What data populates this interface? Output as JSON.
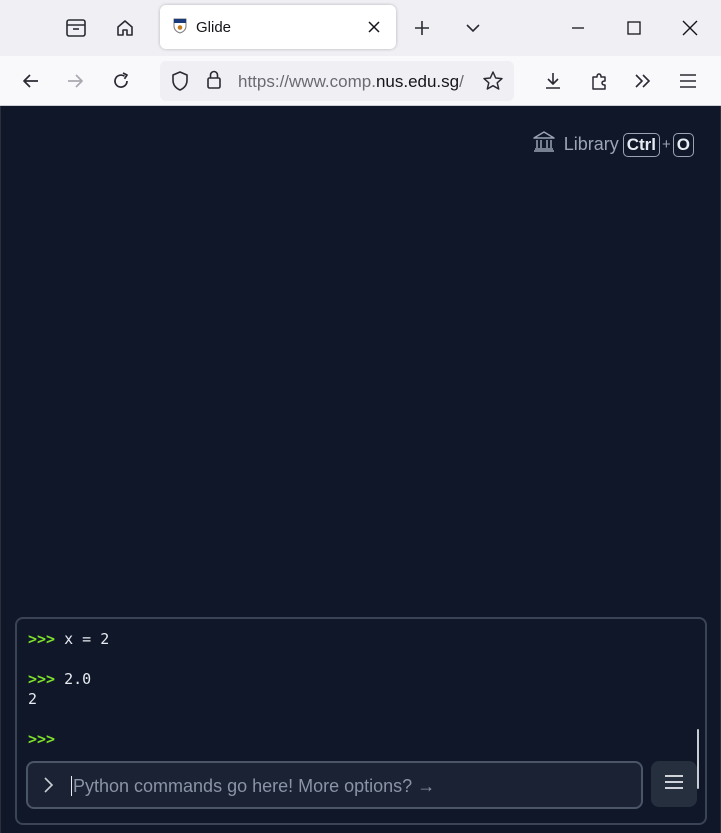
{
  "browser": {
    "tab": {
      "title": "Glide"
    },
    "address_bar": {
      "url_prefix": "https://www.comp.",
      "url_host": "nus.edu.sg",
      "url_suffix": "/"
    }
  },
  "library": {
    "label": "Library",
    "shortcut_key1": "Ctrl",
    "shortcut_plus": "+",
    "shortcut_key2": "O"
  },
  "console": {
    "lines": [
      {
        "prompt": ">>>",
        "text": " x = 2"
      },
      {
        "prompt": "",
        "text": ""
      },
      {
        "prompt": ">>>",
        "text": " 2.0"
      },
      {
        "prompt": "",
        "text": "2"
      },
      {
        "prompt": "",
        "text": ""
      },
      {
        "prompt": ">>>",
        "text": ""
      }
    ],
    "input_placeholder": "Python commands go here! More options? →"
  },
  "colors": {
    "background": "#0f1729",
    "prompt": "#7ee02a",
    "text": "#e8ebf0"
  }
}
